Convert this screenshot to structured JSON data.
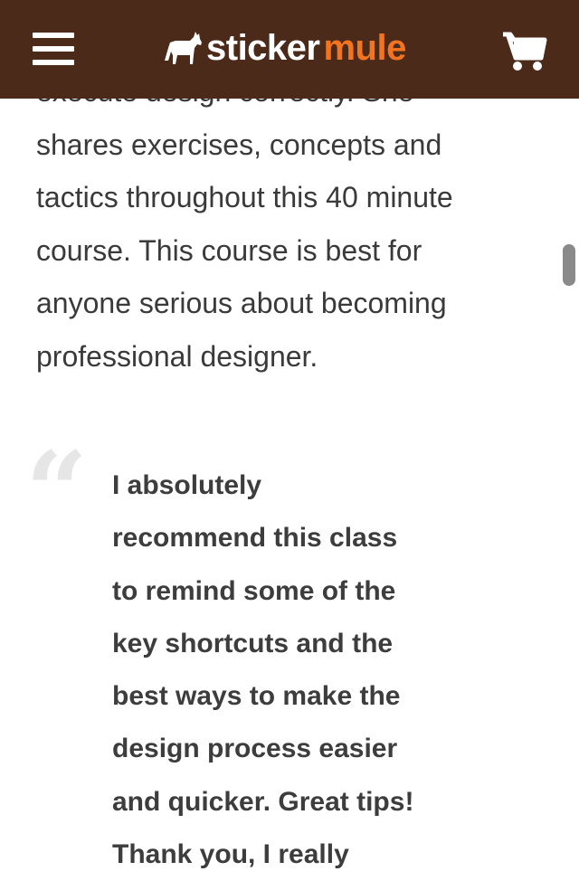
{
  "header": {
    "logo_sticker": "sticker",
    "logo_mule": "mule",
    "menu_icon": "hamburger-menu-icon",
    "cart_icon": "shopping-cart-icon",
    "brand_color": "#4b2a1a",
    "accent_color": "#f37321"
  },
  "article": {
    "partial_line": "execute design correctly. She",
    "line2": "shares exercises, concepts and",
    "line3": "tactics throughout this 40 minute",
    "line4": "course. This course is best for",
    "line5": "anyone serious about becoming",
    "line6": "professional designer."
  },
  "testimonial": {
    "quote_mark": "“",
    "line1": "I absolutely",
    "line2": "recommend this class",
    "line3": "to remind some of the",
    "line4": "key shortcuts and the",
    "line5": "best ways to make the",
    "line6": "design process easier",
    "line7": "and quicker. Great tips!",
    "line8": "Thank you, I really"
  }
}
